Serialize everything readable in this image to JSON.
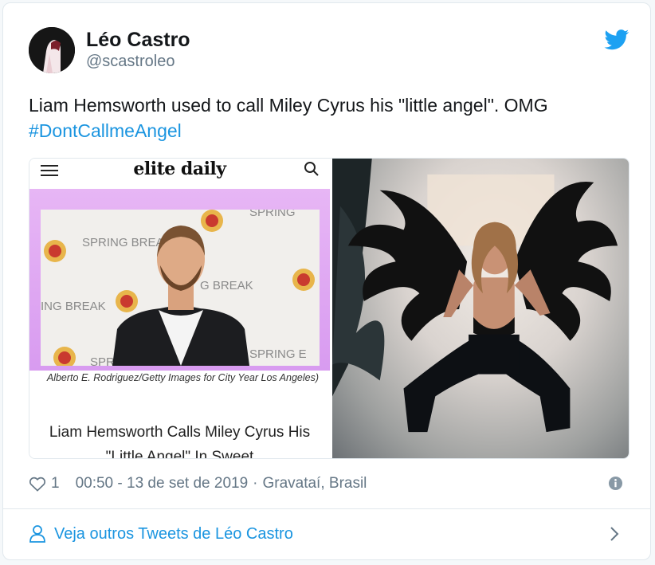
{
  "user": {
    "name": "Léo Castro",
    "handle": "@scastroleo"
  },
  "tweet": {
    "text": "Liam Hemsworth used to call Miley Cyrus his \"little angel\". OMG ",
    "hashtag": "#DontCallmeAngel"
  },
  "media": {
    "left_card": {
      "site_logo": "elite daily",
      "photo_caption": "Alberto E. Rodriguez/Getty Images for City Year Los Angeles)",
      "headline": "Liam Hemsworth Calls Miley Cyrus His \"Little Angel\" In Sweet"
    }
  },
  "meta": {
    "like_count": "1",
    "timestamp": "00:50 - 13 de set de 2019",
    "separator": "·",
    "location": "Gravataí, Brasil"
  },
  "footer": {
    "link_text": "Veja outros Tweets de Léo Castro"
  },
  "colors": {
    "accent": "#1b95e0",
    "secondary_text": "#657786",
    "border": "#e1e8ed"
  },
  "icons": {
    "brand": "twitter-bird-icon",
    "like": "heart-icon",
    "info": "info-icon",
    "profile": "user-icon",
    "more": "chevron-right-icon"
  }
}
